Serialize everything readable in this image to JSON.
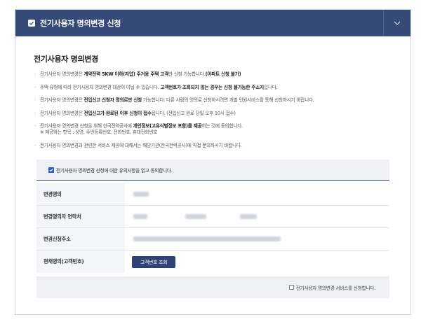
{
  "header": {
    "title": "전기사용자 명의변경 신청",
    "checked": true,
    "toggle_icon": "chevron-down-icon"
  },
  "section": {
    "title": "전기사용자 명의변경",
    "notes": [
      {
        "pre": "전기사용자 명의변경은 ",
        "bold": "계약전력 5KW 이하(저압) 주거용 주택 고객",
        "post": "만 신청 가능합니다.",
        "bold2": "(아파트 신청 불가)",
        "post2": ""
      },
      {
        "pre": "주택 유형에 따라 전기사용자 명의변경 대상이 아닐 수 있습니다. ",
        "bold": "고객번호가 조회되지 않는 경우는 신청 불가능한 주소지",
        "post": "입니다.",
        "bold2": "",
        "post2": ""
      },
      {
        "pre": "전기사용자 명의변경은 ",
        "bold": "전입신고 신청자 명의로만 신청",
        "post": " 가능합니다. 다른 사람의 명의로 신청하시려면 개별 민원서비스를 통해 신청하시기 바랍니다.",
        "bold2": "",
        "post2": ""
      },
      {
        "pre": "전기사용자 명의변경은 ",
        "bold": "전입신고가 완료된 이후 신청이 접수",
        "post": "됩니다. (전입신고 완료 당일 오후 10시 접수)",
        "bold2": "",
        "post2": ""
      },
      {
        "pre": "전기사용자 명의변경 신청을 위해 한국전력공사에 ",
        "bold": "개인정보(고유식별정보 포함)를 제공",
        "post": "하는 것에 동의합니다.",
        "bold2": "",
        "post2": "",
        "sub": "※ 제공하는 항목 : 성명, 주민등록번호, 전화번호, 휴대전화번호"
      },
      {
        "pre": "전기사용자 명의변경과 관련한 서비스 제공에 대해서는 해당기관(한국전력공사)에 직접 문의하시기 바랍니다.",
        "bold": "",
        "post": "",
        "bold2": "",
        "post2": ""
      }
    ]
  },
  "agreement": {
    "label": "전기사용자 명의변경 신청에 대한 유의사항을 읽고 동의합니다.",
    "checked": true
  },
  "form": {
    "rows": [
      {
        "label": "변경명의"
      },
      {
        "label": "변경명의자 연락처"
      },
      {
        "label": "변경신청주소"
      },
      {
        "label": "현재명의(고객번호)"
      }
    ],
    "lookup_button": "고객번호 조회"
  },
  "apply": {
    "label": "전기사용자 명의변경 서비스를 신청합니다.",
    "checked": false
  },
  "colors": {
    "header_bg": "#364a78",
    "button_bg": "#2e4273",
    "checkbox_blue": "#2b5dd1"
  }
}
